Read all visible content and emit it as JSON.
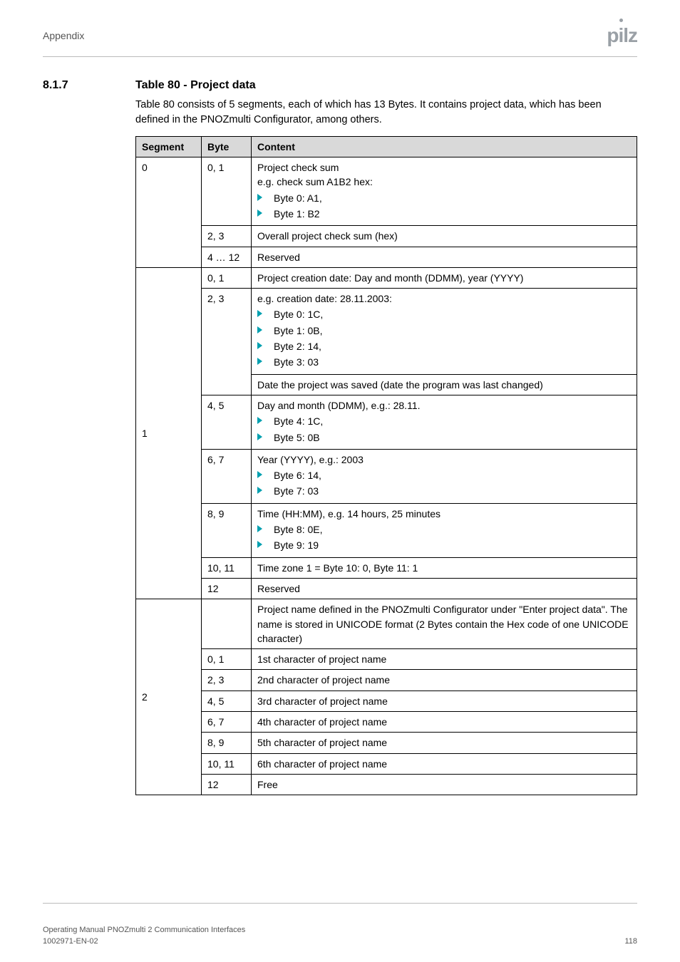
{
  "header": {
    "section": "Appendix",
    "logo": "pilz"
  },
  "section": {
    "number": "8.1.7",
    "title": "Table 80 - Project data",
    "intro": "Table 80 consists of 5 segments, each of which has 13 Bytes. It contains project data, which has been defined in the PNOZmulti Configurator, among others."
  },
  "table": {
    "headers": {
      "segment": "Segment",
      "byte": "Byte",
      "content": "Content"
    },
    "seg0": {
      "label": "0",
      "r1": {
        "byte": "0, 1",
        "line1": "Project check sum",
        "line2": "e.g. check sum A1B2 hex:",
        "b1": "Byte 0: A1,",
        "b2": "Byte 1: B2"
      },
      "r2": {
        "byte": "2, 3",
        "content": "Overall project check sum (hex)"
      },
      "r3": {
        "byte": "4 … 12",
        "content": "Reserved"
      }
    },
    "seg1": {
      "label": "1",
      "r1": {
        "byte": "0, 1",
        "content": "Project creation date: Day and month (DDMM), year (YYYY)"
      },
      "r2": {
        "byte": "2, 3",
        "line1": "e.g. creation date: 28.11.2003:",
        "b1": "Byte 0: 1C,",
        "b2": "Byte 1: 0B,",
        "b3": "Byte 2: 14,",
        "b4": "Byte 3: 03"
      },
      "r3": {
        "content": "Date the project was saved (date the program was last changed)"
      },
      "r4": {
        "byte": "4, 5",
        "line1": "Day and month (DDMM), e.g.: 28.11.",
        "b1": "Byte 4: 1C,",
        "b2": "Byte 5: 0B"
      },
      "r5": {
        "byte": "6, 7",
        "line1": "Year (YYYY), e.g.: 2003",
        "b1": "Byte 6: 14,",
        "b2": "Byte 7: 03"
      },
      "r6": {
        "byte": "8, 9",
        "line1": "Time (HH:MM), e.g. 14 hours, 25 minutes",
        "b1": "Byte 8: 0E,",
        "b2": "Byte 9: 19"
      },
      "r7": {
        "byte": "10, 11",
        "content": "Time zone 1 = Byte 10: 0, Byte 11: 1"
      },
      "r8": {
        "byte": "12",
        "content": "Reserved"
      }
    },
    "seg2": {
      "label": "2",
      "r1": {
        "byte": "",
        "content": "Project name defined in the PNOZmulti Configurator under \"Enter project data\". The name is stored in UNICODE format (2 Bytes contain the Hex code of one UNICODE character)"
      },
      "r2": {
        "byte": "0, 1",
        "content": "1st character of project name"
      },
      "r3": {
        "byte": "2, 3",
        "content": "2nd character of project name"
      },
      "r4": {
        "byte": "4, 5",
        "content": "3rd character of project name"
      },
      "r5": {
        "byte": "6, 7",
        "content": "4th character of project name"
      },
      "r6": {
        "byte": "8, 9",
        "content": "5th character of project name"
      },
      "r7": {
        "byte": "10, 11",
        "content": "6th character of project name"
      },
      "r8": {
        "byte": "12",
        "content": "Free"
      }
    }
  },
  "footer": {
    "line1": "Operating Manual PNOZmulti 2 Communication Interfaces",
    "line2": "1002971-EN-02",
    "page": "118"
  }
}
